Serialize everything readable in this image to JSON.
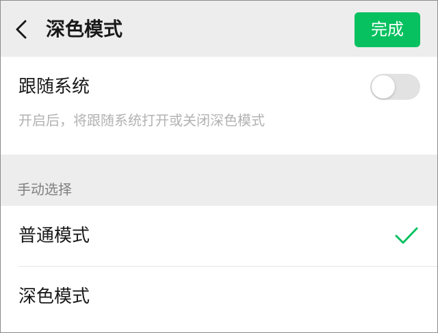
{
  "header": {
    "back_icon": "chevron-left-icon",
    "title": "深色模式",
    "done_label": "完成"
  },
  "follow_system": {
    "label": "跟随系统",
    "enabled": false,
    "hint": "开启后，将跟随系统打开或关闭深色模式"
  },
  "manual": {
    "section_title": "手动选择",
    "options": [
      {
        "label": "普通模式",
        "selected": true
      },
      {
        "label": "深色模式",
        "selected": false
      }
    ],
    "check_icon": "checkmark-icon"
  },
  "colors": {
    "accent": "#07c160",
    "background": "#ededed",
    "card": "#ffffff",
    "toggle_off": "#e2e2e2",
    "hint_text": "#b2b2b2",
    "section_text": "#7f7f7f"
  }
}
